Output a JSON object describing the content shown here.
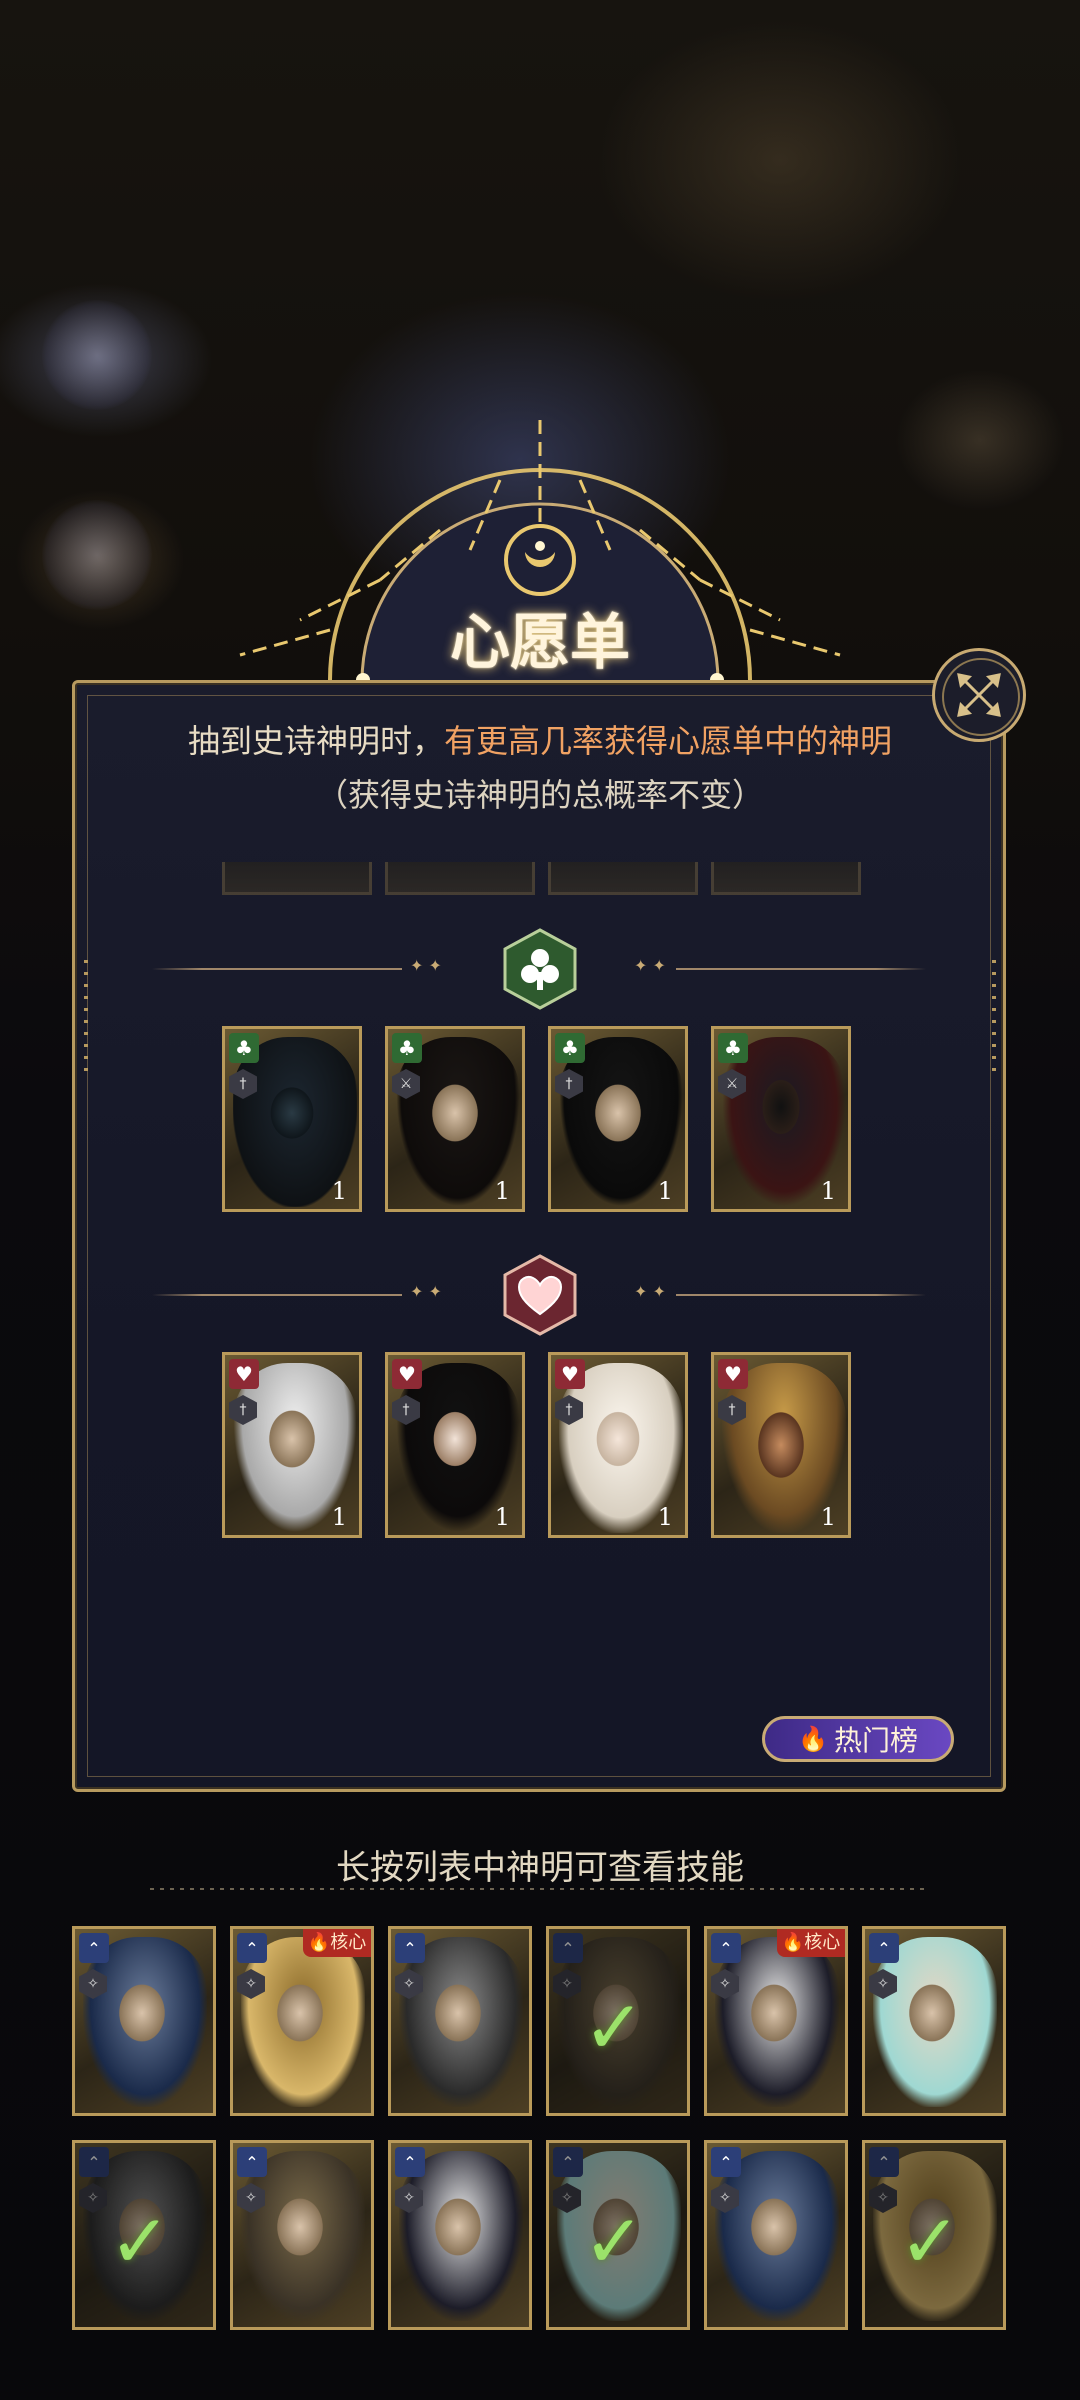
{
  "panel": {
    "title": "心愿单",
    "desc_normal": "抽到史诗神明时，",
    "desc_highlight": "有更高几率获得心愿单中的神明",
    "subtitle": "（获得史诗神明的总概率不变）",
    "hot_button": "热门榜"
  },
  "groups": [
    {
      "suit": "club",
      "suit_icon": "club-icon",
      "cards": [
        {
          "count": "1"
        },
        {
          "count": "1"
        },
        {
          "count": "1"
        },
        {
          "count": "1"
        }
      ]
    },
    {
      "suit": "heart",
      "suit_icon": "heart-icon",
      "cards": [
        {
          "count": "1"
        },
        {
          "count": "1"
        },
        {
          "count": "1"
        },
        {
          "count": "1"
        }
      ]
    }
  ],
  "hint": "长按列表中神明可查看技能",
  "list": {
    "core_label": "核心",
    "rows": [
      [
        {
          "core": false,
          "selected": false
        },
        {
          "core": true,
          "selected": false
        },
        {
          "core": false,
          "selected": false
        },
        {
          "core": false,
          "selected": true
        },
        {
          "core": true,
          "selected": false
        },
        {
          "core": false,
          "selected": false
        }
      ],
      [
        {
          "core": false,
          "selected": true
        },
        {
          "core": false,
          "selected": false
        },
        {
          "core": false,
          "selected": false
        },
        {
          "core": false,
          "selected": true
        },
        {
          "core": false,
          "selected": false
        },
        {
          "core": false,
          "selected": true
        }
      ]
    ]
  },
  "colors": {
    "accent_gold": "#b79a5f",
    "highlight": "#f1a263",
    "club": "#2f6a33",
    "heart": "#8e2a35",
    "hot_button": "#6a48c2"
  }
}
